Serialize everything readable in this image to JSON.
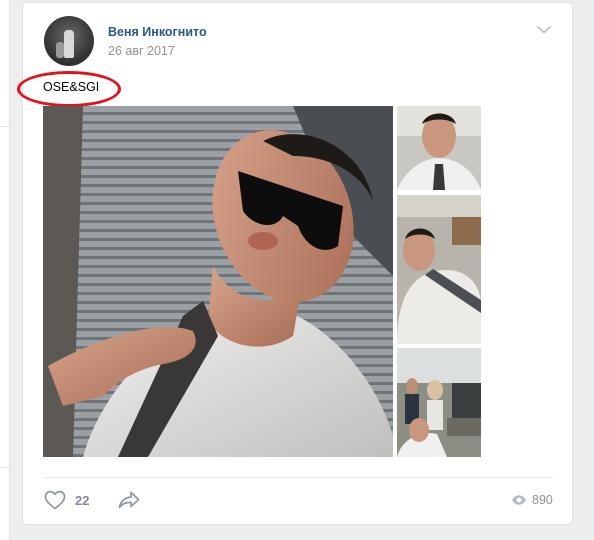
{
  "post": {
    "author_name": "Веня Инкогнито",
    "date": "26 авг 2017",
    "text": "OSE&SGI",
    "photos": [
      {
        "name": "main-photo"
      },
      {
        "name": "thumbnail-1"
      },
      {
        "name": "thumbnail-2"
      },
      {
        "name": "thumbnail-3"
      }
    ],
    "likes": "22",
    "views": "890"
  },
  "colors": {
    "author_link": "#2a5885",
    "muted": "#939393",
    "highlight_ring": "#e0131a",
    "page_bg": "#edeef0"
  },
  "icons": {
    "options": "chevron-down-icon",
    "like": "heart-icon",
    "share": "share-arrow-icon",
    "views": "eye-icon"
  }
}
